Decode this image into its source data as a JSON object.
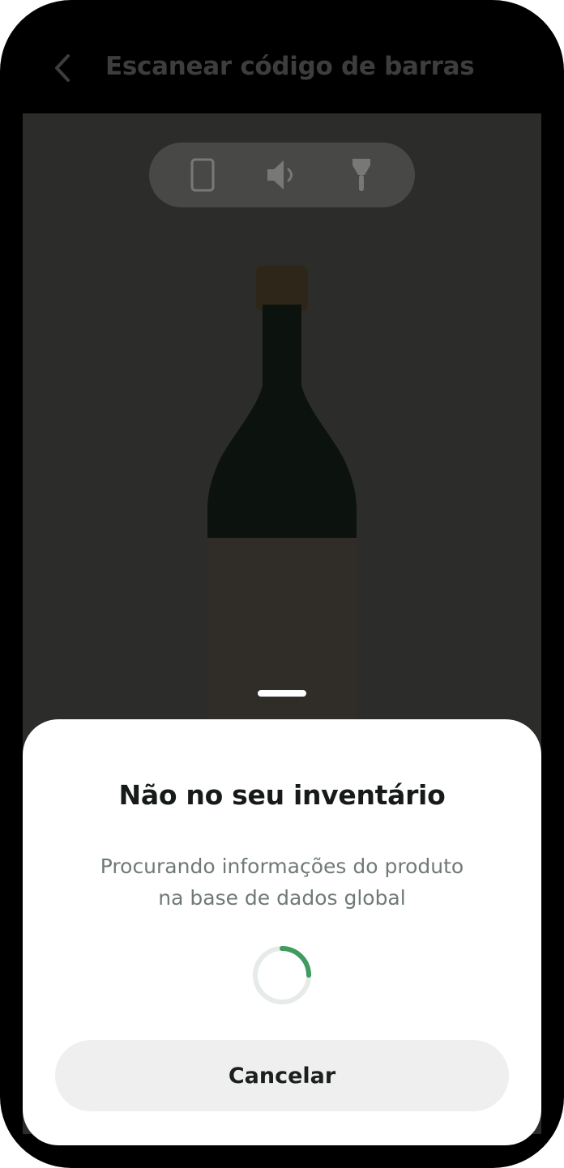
{
  "header": {
    "title": "Escanear código de barras"
  },
  "camera_controls": {
    "icons": [
      "phone-outline-icon",
      "speaker-icon",
      "flashlight-icon"
    ]
  },
  "sheet": {
    "title": "Não no seu inventário",
    "description_line1": "Procurando informações do produto",
    "description_line2": "na base de dados global",
    "cancel_label": "Cancelar"
  },
  "colors": {
    "accent_green": "#3f9b5f",
    "camera_bg": "#2c2c2a",
    "sheet_bg": "#ffffff"
  }
}
